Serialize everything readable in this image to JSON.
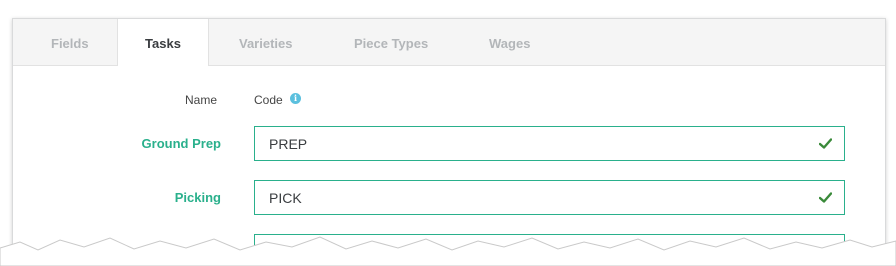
{
  "tabs": [
    {
      "label": "Fields",
      "active": false
    },
    {
      "label": "Tasks",
      "active": true
    },
    {
      "label": "Varieties",
      "active": false
    },
    {
      "label": "Piece Types",
      "active": false
    },
    {
      "label": "Wages",
      "active": false
    }
  ],
  "table": {
    "name_header": "Name",
    "code_header": "Code",
    "code_header_icon": "info-icon",
    "rows": [
      {
        "name": "Ground Prep",
        "code": "PREP",
        "status_icon": "check-icon",
        "valid": true
      },
      {
        "name": "Picking",
        "code": "PICK",
        "status_icon": "check-icon",
        "valid": true
      }
    ]
  },
  "colors": {
    "accent": "#2ab08c",
    "check": "#3a8a3a",
    "info": "#5bc0de",
    "inactive_tab": "#b3b6b9"
  }
}
